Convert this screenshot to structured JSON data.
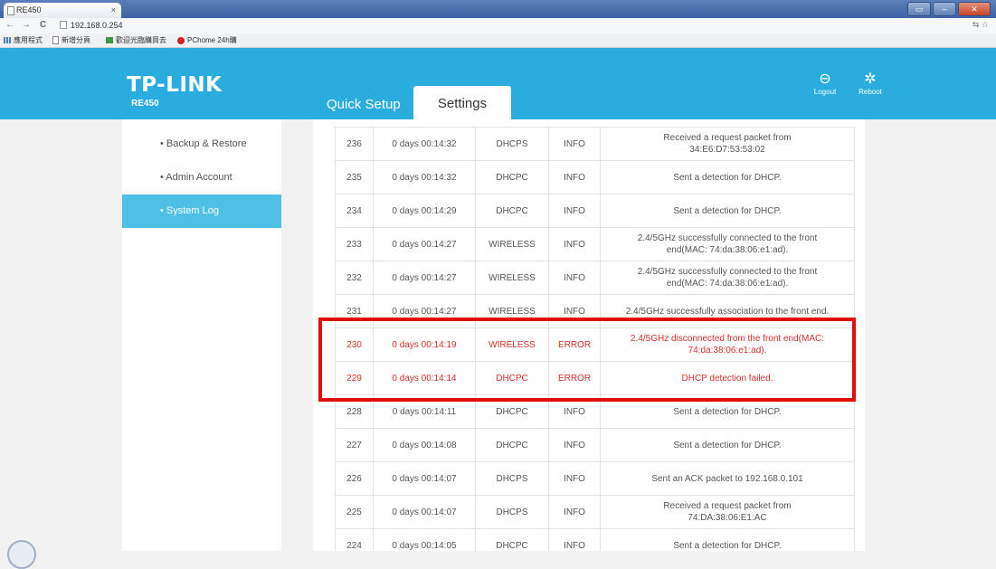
{
  "browser": {
    "tab_title": "RE450",
    "tab_close": "×",
    "url": "192.168.0.254",
    "back": "←",
    "forward": "→",
    "reload": "C",
    "bookmarks": [
      "應用程式",
      "新增分頁",
      "歡迎光臨購買去",
      "PChome 24h購"
    ],
    "window_controls": [
      "▭",
      "–",
      "✕"
    ]
  },
  "header": {
    "logo": "TP-LINK",
    "model": "RE450",
    "nav_quick_setup": "Quick Setup",
    "nav_settings": "Settings",
    "logout_label": "Logout",
    "reboot_label": "Reboot"
  },
  "sidebar": {
    "items": [
      {
        "label": "• Backup & Restore"
      },
      {
        "label": "• Admin Account"
      },
      {
        "label": "• System Log"
      }
    ]
  },
  "log": {
    "rows": [
      {
        "id": "236",
        "time": "0 days 00:14:32",
        "module": "DHCPS",
        "level": "INFO",
        "msg1": "Received a request packet from",
        "msg2": "34:E6:D7:53:53:02"
      },
      {
        "id": "235",
        "time": "0 days 00:14:32",
        "module": "DHCPC",
        "level": "INFO",
        "msg1": "Sent a detection for DHCP.",
        "msg2": ""
      },
      {
        "id": "234",
        "time": "0 days 00:14:29",
        "module": "DHCPC",
        "level": "INFO",
        "msg1": "Sent a detection for DHCP.",
        "msg2": ""
      },
      {
        "id": "233",
        "time": "0 days 00:14:27",
        "module": "WIRELESS",
        "level": "INFO",
        "msg1": "2.4/5GHz successfully connected to the front",
        "msg2": "end(MAC: 74:da:38:06:e1:ad)."
      },
      {
        "id": "232",
        "time": "0 days 00:14:27",
        "module": "WIRELESS",
        "level": "INFO",
        "msg1": "2.4/5GHz successfully connected to the front",
        "msg2": "end(MAC: 74:da:38:06:e1:ad)."
      },
      {
        "id": "231",
        "time": "0 days 00:14:27",
        "module": "WIRELESS",
        "level": "INFO",
        "msg1": "2.4/5GHz successfully association to the front end.",
        "msg2": ""
      },
      {
        "id": "230",
        "time": "0 days 00:14:19",
        "module": "WIRELESS",
        "level": "ERROR",
        "msg1": "2.4/5GHz disconnected from the front end(MAC:",
        "msg2": "74:da:38:06:e1:ad)."
      },
      {
        "id": "229",
        "time": "0 days 00:14:14",
        "module": "DHCPC",
        "level": "ERROR",
        "msg1": "DHCP detection failed.",
        "msg2": ""
      },
      {
        "id": "228",
        "time": "0 days 00:14:11",
        "module": "DHCPC",
        "level": "INFO",
        "msg1": "Sent a detection for DHCP.",
        "msg2": ""
      },
      {
        "id": "227",
        "time": "0 days 00:14:08",
        "module": "DHCPC",
        "level": "INFO",
        "msg1": "Sent a detection for DHCP.",
        "msg2": ""
      },
      {
        "id": "226",
        "time": "0 days 00:14:07",
        "module": "DHCPS",
        "level": "INFO",
        "msg1": "Sent an ACK packet to 192.168.0.101",
        "msg2": ""
      },
      {
        "id": "225",
        "time": "0 days 00:14:07",
        "module": "DHCPS",
        "level": "INFO",
        "msg1": "Received a request packet from",
        "msg2": "74:DA:38:06:E1:AC"
      },
      {
        "id": "224",
        "time": "0 days 00:14:05",
        "module": "DHCPC",
        "level": "INFO",
        "msg1": "Sent a detection for DHCP.",
        "msg2": ""
      }
    ]
  },
  "colors": {
    "brand": "#2aacdf",
    "sidebar_active": "#4ec0e6",
    "error_text": "#d9302a",
    "highlight_box": "#e10d0d"
  }
}
